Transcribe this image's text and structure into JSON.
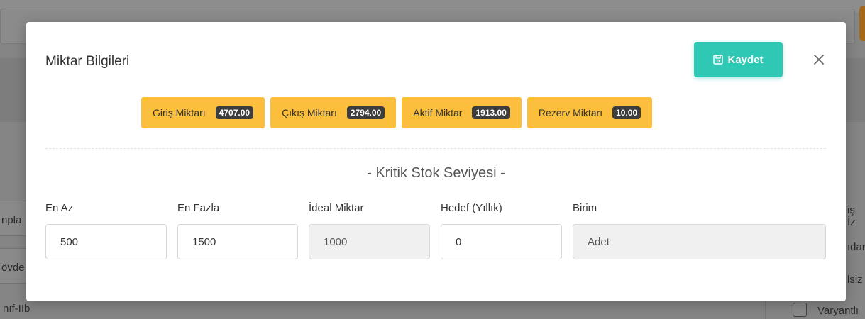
{
  "background": {
    "left_fragments": [
      "npla",
      "övde",
      "nıf-IIb"
    ],
    "right_fragments": [
      "iş İz",
      "ıdar",
      "lsiz"
    ],
    "checkbox_label": "Varyantlı"
  },
  "modal": {
    "title": "Miktar Bilgileri",
    "save_label": "Kaydet",
    "badges": [
      {
        "label": "Giriş Miktarı",
        "value": "4707.00"
      },
      {
        "label": "Çıkış Miktarı",
        "value": "2794.00"
      },
      {
        "label": "Aktif Miktar",
        "value": "1913.00"
      },
      {
        "label": "Rezerv Miktarı",
        "value": "10.00"
      }
    ],
    "section_title": "- Kritik Stok Seviyesi -",
    "fields": {
      "min": {
        "label": "En Az",
        "value": "500"
      },
      "max": {
        "label": "En Fazla",
        "value": "1500"
      },
      "ideal": {
        "label": "İdeal Miktar",
        "value": "1000"
      },
      "target": {
        "label": "Hedef (Yıllık)",
        "value": "0"
      },
      "unit": {
        "label": "Birim",
        "value": "Adet"
      }
    }
  },
  "colors": {
    "accent": "#2ec8b4",
    "badge": "#fbbf3d",
    "badge_count": "#3d3d3d"
  }
}
